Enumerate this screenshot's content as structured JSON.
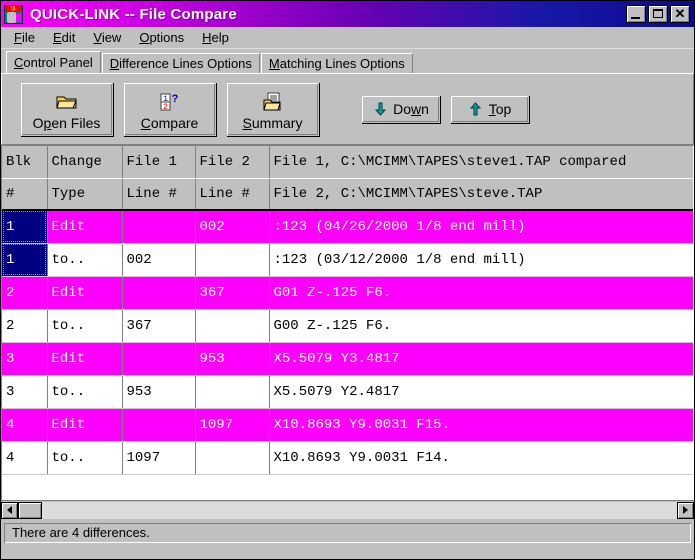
{
  "window": {
    "title": "QUICK-LINK --  File Compare",
    "icon": "app-logo-icon",
    "minimize_label": "",
    "maximize_label": "",
    "close_label": "✕",
    "titlebar_gradient_start": "#ff00ff",
    "titlebar_gradient_end": "#000080"
  },
  "menu": {
    "items": [
      {
        "label": "File",
        "accel": "F"
      },
      {
        "label": "Edit",
        "accel": "E"
      },
      {
        "label": "View",
        "accel": "V"
      },
      {
        "label": "Options",
        "accel": "O"
      },
      {
        "label": "Help",
        "accel": "H"
      }
    ]
  },
  "tabs": [
    {
      "label": "Control Panel",
      "accel": "C",
      "active": true
    },
    {
      "label": "Difference Lines Options",
      "accel": "D",
      "active": false
    },
    {
      "label": "Matching Lines Options",
      "accel": "M",
      "active": false
    }
  ],
  "toolbar": {
    "buttons": [
      {
        "label": "Open Files",
        "accel": "p",
        "icon": "open-folder-icon",
        "size": "big"
      },
      {
        "label": "Compare",
        "accel": "C",
        "icon": "compare-1-2-icon",
        "size": "big"
      },
      {
        "label": "Summary",
        "accel": "S",
        "icon": "summary-doc-icon",
        "size": "big"
      },
      {
        "label": "Down",
        "accel": "w",
        "icon": "arrow-down-icon",
        "size": "small"
      },
      {
        "label": "Top",
        "accel": "T",
        "icon": "arrow-up-icon",
        "size": "small"
      }
    ]
  },
  "grid": {
    "headers_row1": [
      "Blk",
      "Change",
      "File 1",
      "File 2",
      "File 1, C:\\MCIMM\\TAPES\\steve1.TAP compared"
    ],
    "headers_row2": [
      "#",
      "Type",
      "Line #",
      "Line #",
      "File 2, C:\\MCIMM\\TAPES\\steve.TAP"
    ],
    "rows": [
      {
        "blk": "1",
        "change": "Edit",
        "file1_line": "",
        "file2_line": "002",
        "text": ":123 (04/26/2000 1/8 end mill)",
        "kind": "diff",
        "blk_state": "selected"
      },
      {
        "blk": "1",
        "change": "to..",
        "file1_line": "002",
        "file2_line": "",
        "text": ":123 (03/12/2000 1/8 end mill)",
        "kind": "same",
        "blk_state": "selected"
      },
      {
        "blk": "2",
        "change": "Edit",
        "file1_line": "",
        "file2_line": "367",
        "text": "G01 Z-.125 F6.",
        "kind": "diff",
        "blk_state": "normal"
      },
      {
        "blk": "2",
        "change": "to..",
        "file1_line": "367",
        "file2_line": "",
        "text": "G00 Z-.125 F6.",
        "kind": "same",
        "blk_state": "normal"
      },
      {
        "blk": "3",
        "change": "Edit",
        "file1_line": "",
        "file2_line": "953",
        "text": "X5.5079 Y3.4817",
        "kind": "diff",
        "blk_state": "normal"
      },
      {
        "blk": "3",
        "change": "to..",
        "file1_line": "953",
        "file2_line": "",
        "text": "X5.5079 Y2.4817",
        "kind": "same",
        "blk_state": "normal"
      },
      {
        "blk": "4",
        "change": "Edit",
        "file1_line": "",
        "file2_line": "1097",
        "text": "X10.8693 Y9.0031 F15.",
        "kind": "diff",
        "blk_state": "normal"
      },
      {
        "blk": "4",
        "change": "to..",
        "file1_line": "1097",
        "file2_line": "",
        "text": "X10.8693 Y9.0031 F14.",
        "kind": "same",
        "blk_state": "normal"
      }
    ],
    "diff_row_bg": "#ff00ff",
    "diff_row_fg": "#ffffff",
    "selected_cell_bg": "#000080"
  },
  "scrollbar": {
    "left_arrow": "scroll-left-icon",
    "right_arrow": "scroll-right-icon"
  },
  "statusbar": {
    "message": "There are 4 differences."
  }
}
